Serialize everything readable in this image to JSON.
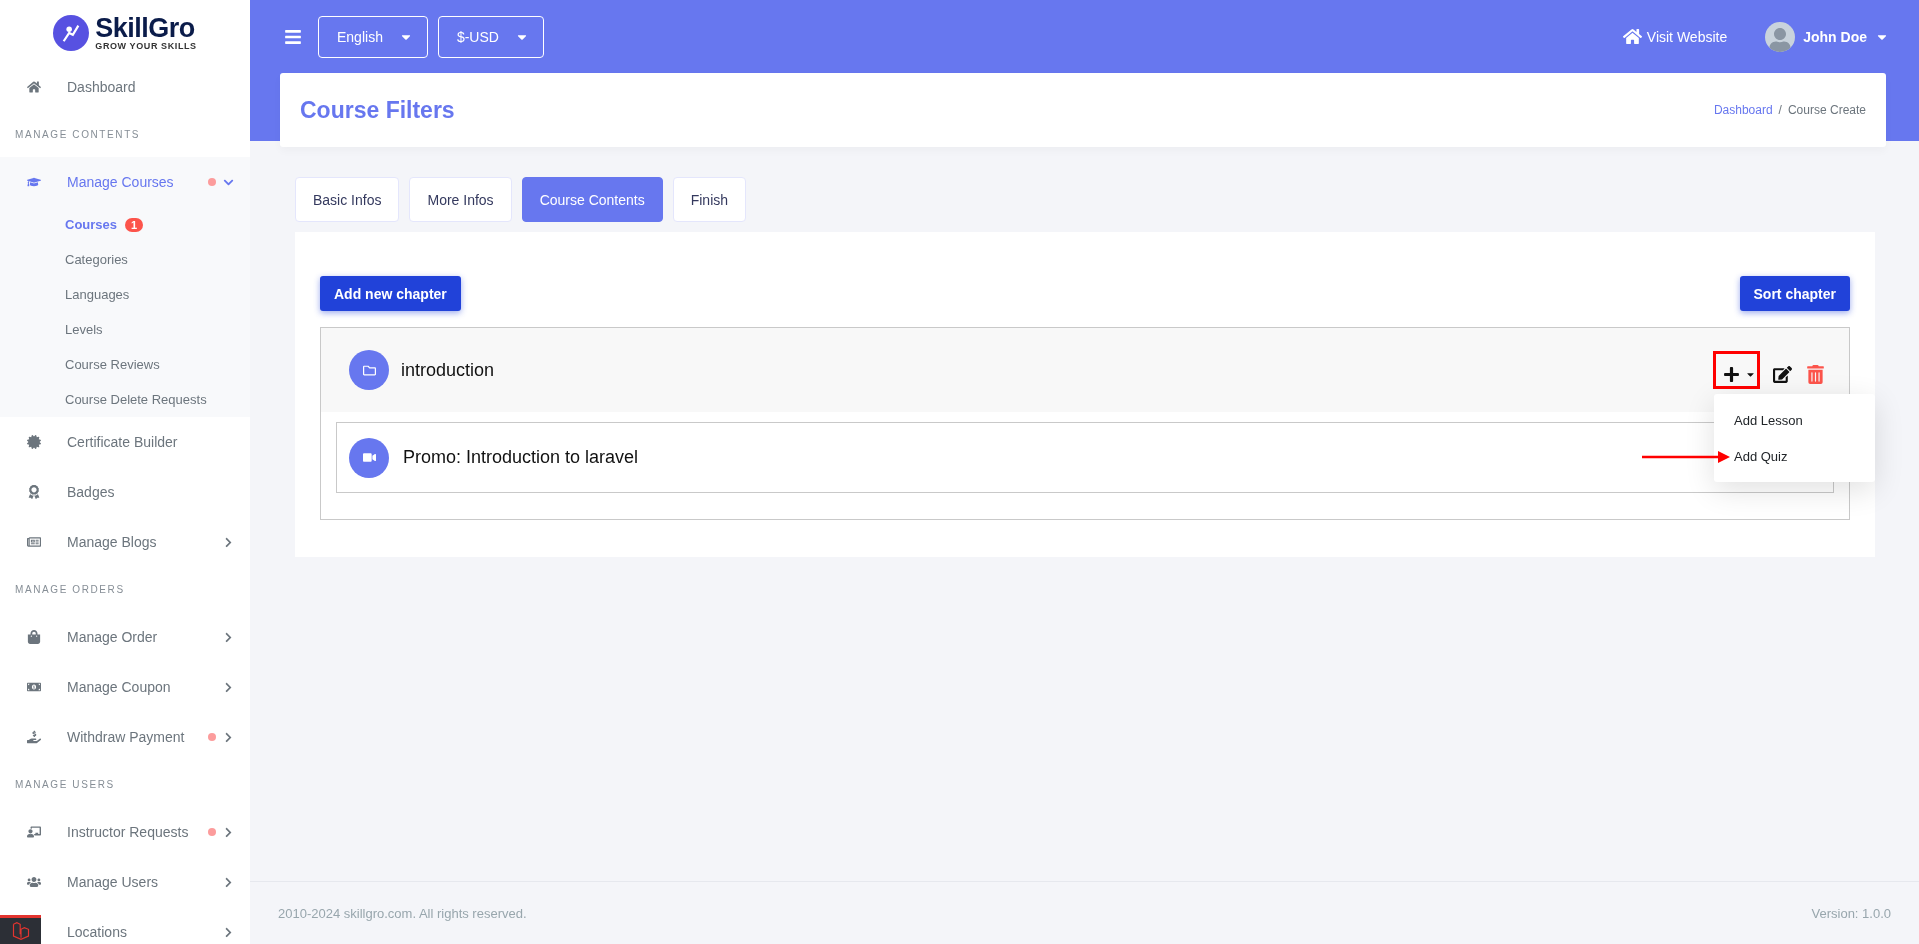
{
  "brand": {
    "name": "SkillGro",
    "tagline": "GROW YOUR SKILLS"
  },
  "sidebar": {
    "sections": [
      {
        "items": [
          {
            "label": "Dashboard",
            "selected": false
          }
        ]
      },
      {
        "heading": "MANAGE CONTENTS",
        "items": [
          {
            "label": "Manage Courses",
            "selected": true,
            "dot": true,
            "expandable": true,
            "expanded": true,
            "children": [
              {
                "label": "Courses",
                "selected": true,
                "badge": "1"
              },
              {
                "label": "Categories",
                "selected": false
              },
              {
                "label": "Languages",
                "selected": false
              },
              {
                "label": "Levels",
                "selected": false
              },
              {
                "label": "Course Reviews",
                "selected": false
              },
              {
                "label": "Course Delete Requests",
                "selected": false
              }
            ]
          },
          {
            "label": "Certificate Builder",
            "selected": false
          },
          {
            "label": "Badges",
            "selected": false
          },
          {
            "label": "Manage Blogs",
            "selected": false,
            "expandable": true,
            "expanded": false
          }
        ]
      },
      {
        "heading": "MANAGE ORDERS",
        "items": [
          {
            "label": "Manage Order",
            "selected": false,
            "expandable": true,
            "expanded": false
          },
          {
            "label": "Manage Coupon",
            "selected": false,
            "expandable": true,
            "expanded": false
          },
          {
            "label": "Withdraw Payment",
            "selected": false,
            "dot": true,
            "expandable": true,
            "expanded": false
          }
        ]
      },
      {
        "heading": "MANAGE USERS",
        "items": [
          {
            "label": "Instructor Requests",
            "selected": false,
            "dot": true,
            "expandable": true,
            "expanded": false
          },
          {
            "label": "Manage Users",
            "selected": false,
            "expandable": true,
            "expanded": false
          },
          {
            "label": "Locations",
            "selected": false,
            "expandable": true,
            "expanded": false
          }
        ]
      }
    ]
  },
  "topbar": {
    "language": "English",
    "currency": "$-USD",
    "visit_link": "Visit Website",
    "user": "John Doe"
  },
  "page_header": {
    "title": "Course Filters",
    "breadcrumb": [
      "Dashboard",
      "Course Create"
    ],
    "separator": "/"
  },
  "tabs": [
    {
      "label": "Basic Infos",
      "selected": false
    },
    {
      "label": "More Infos",
      "selected": false
    },
    {
      "label": "Course Contents",
      "selected": true
    },
    {
      "label": "Finish",
      "selected": false
    }
  ],
  "actions": {
    "add_chapter": "Add new chapter",
    "sort_chapter": "Sort chapter"
  },
  "chapters": [
    {
      "title": "introduction",
      "add_menu": {
        "expanded": true,
        "items": [
          "Add Lesson",
          "Add Quiz"
        ]
      },
      "lessons": [
        {
          "title": "Promo: Introduction to laravel"
        }
      ]
    }
  ],
  "footer": {
    "copyright": "2010-2024 skillgro.com. All rights reserved.",
    "version": "Version: 1.0.0"
  }
}
